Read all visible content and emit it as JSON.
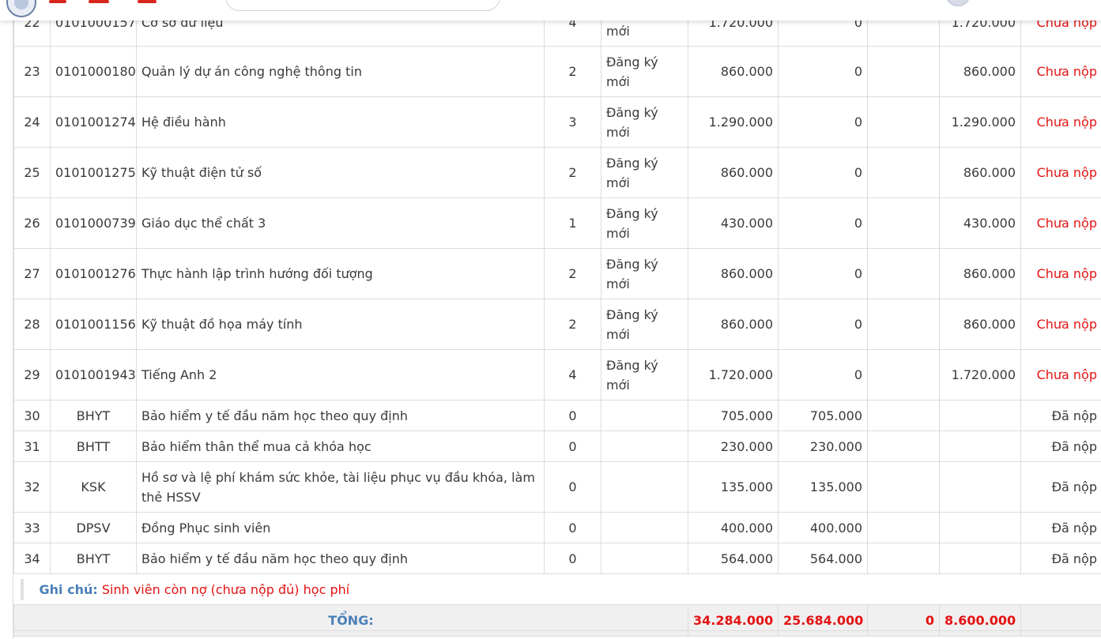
{
  "rows": [
    {
      "stt": "22",
      "code": "0101000157",
      "name": "Cơ sở dữ liệu",
      "credits": "4",
      "type": "mới",
      "amount": "1.720.000",
      "paid": "0",
      "exempt": "",
      "debt": "1.720.000",
      "status": "Chưa nộp"
    },
    {
      "stt": "23",
      "code": "0101000180",
      "name": "Quản lý dự án công nghệ thông tin",
      "credits": "2",
      "type": "Đăng ký mới",
      "amount": "860.000",
      "paid": "0",
      "exempt": "",
      "debt": "860.000",
      "status": "Chưa nộp"
    },
    {
      "stt": "24",
      "code": "0101001274",
      "name": "Hệ điều hành",
      "credits": "3",
      "type": "Đăng ký mới",
      "amount": "1.290.000",
      "paid": "0",
      "exempt": "",
      "debt": "1.290.000",
      "status": "Chưa nộp"
    },
    {
      "stt": "25",
      "code": "0101001275",
      "name": "Kỹ thuật điện tử số",
      "credits": "2",
      "type": "Đăng ký mới",
      "amount": "860.000",
      "paid": "0",
      "exempt": "",
      "debt": "860.000",
      "status": "Chưa nộp"
    },
    {
      "stt": "26",
      "code": "0101000739",
      "name": "Giáo dục thể chất 3",
      "credits": "1",
      "type": "Đăng ký mới",
      "amount": "430.000",
      "paid": "0",
      "exempt": "",
      "debt": "430.000",
      "status": "Chưa nộp"
    },
    {
      "stt": "27",
      "code": "0101001276",
      "name": "Thực hành lập trình hướng đối tượng",
      "credits": "2",
      "type": "Đăng ký mới",
      "amount": "860.000",
      "paid": "0",
      "exempt": "",
      "debt": "860.000",
      "status": "Chưa nộp"
    },
    {
      "stt": "28",
      "code": "0101001156",
      "name": "Kỹ thuật đồ họa máy tính",
      "credits": "2",
      "type": "Đăng ký mới",
      "amount": "860.000",
      "paid": "0",
      "exempt": "",
      "debt": "860.000",
      "status": "Chưa nộp"
    },
    {
      "stt": "29",
      "code": "0101001943",
      "name": "Tiếng Anh 2",
      "credits": "4",
      "type": "Đăng ký mới",
      "amount": "1.720.000",
      "paid": "0",
      "exempt": "",
      "debt": "1.720.000",
      "status": "Chưa nộp"
    },
    {
      "stt": "30",
      "code": "BHYT",
      "name": "Bảo hiểm y tế đầu năm học theo quy định",
      "credits": "0",
      "type": "",
      "amount": "705.000",
      "paid": "705.000",
      "exempt": "",
      "debt": "",
      "status": "Đã nộp"
    },
    {
      "stt": "31",
      "code": "BHTT",
      "name": "Bảo hiểm thân thể mua cả khóa học",
      "credits": "0",
      "type": "",
      "amount": "230.000",
      "paid": "230.000",
      "exempt": "",
      "debt": "",
      "status": "Đã nộp"
    },
    {
      "stt": "32",
      "code": "KSK",
      "name": "Hồ sơ và lệ phí khám sức khỏe, tài liệu phục vụ đầu khóa, làm thẻ HSSV",
      "credits": "0",
      "type": "",
      "amount": "135.000",
      "paid": "135.000",
      "exempt": "",
      "debt": "",
      "status": "Đã nộp"
    },
    {
      "stt": "33",
      "code": "DPSV",
      "name": "Đồng Phục sinh viên",
      "credits": "0",
      "type": "",
      "amount": "400.000",
      "paid": "400.000",
      "exempt": "",
      "debt": "",
      "status": "Đã nộp"
    },
    {
      "stt": "34",
      "code": "BHYT",
      "name": "Bảo hiểm y tế đầu năm học theo quy định",
      "credits": "0",
      "type": "",
      "amount": "564.000",
      "paid": "564.000",
      "exempt": "",
      "debt": "",
      "status": "Đã nộp"
    }
  ],
  "note": {
    "label": "Ghi chú:",
    "text": "Sinh viên còn nợ (chưa nộp đủ) học phí"
  },
  "total": {
    "label": "TỔNG:",
    "amount": "34.284.000",
    "paid": "25.684.000",
    "exempt": "0",
    "debt": "8.600.000"
  },
  "colors": {
    "unpaid": "#e41313",
    "label_blue": "#4a80b8",
    "border": "#dcdcdc",
    "total_bg": "#f0f0f0"
  }
}
